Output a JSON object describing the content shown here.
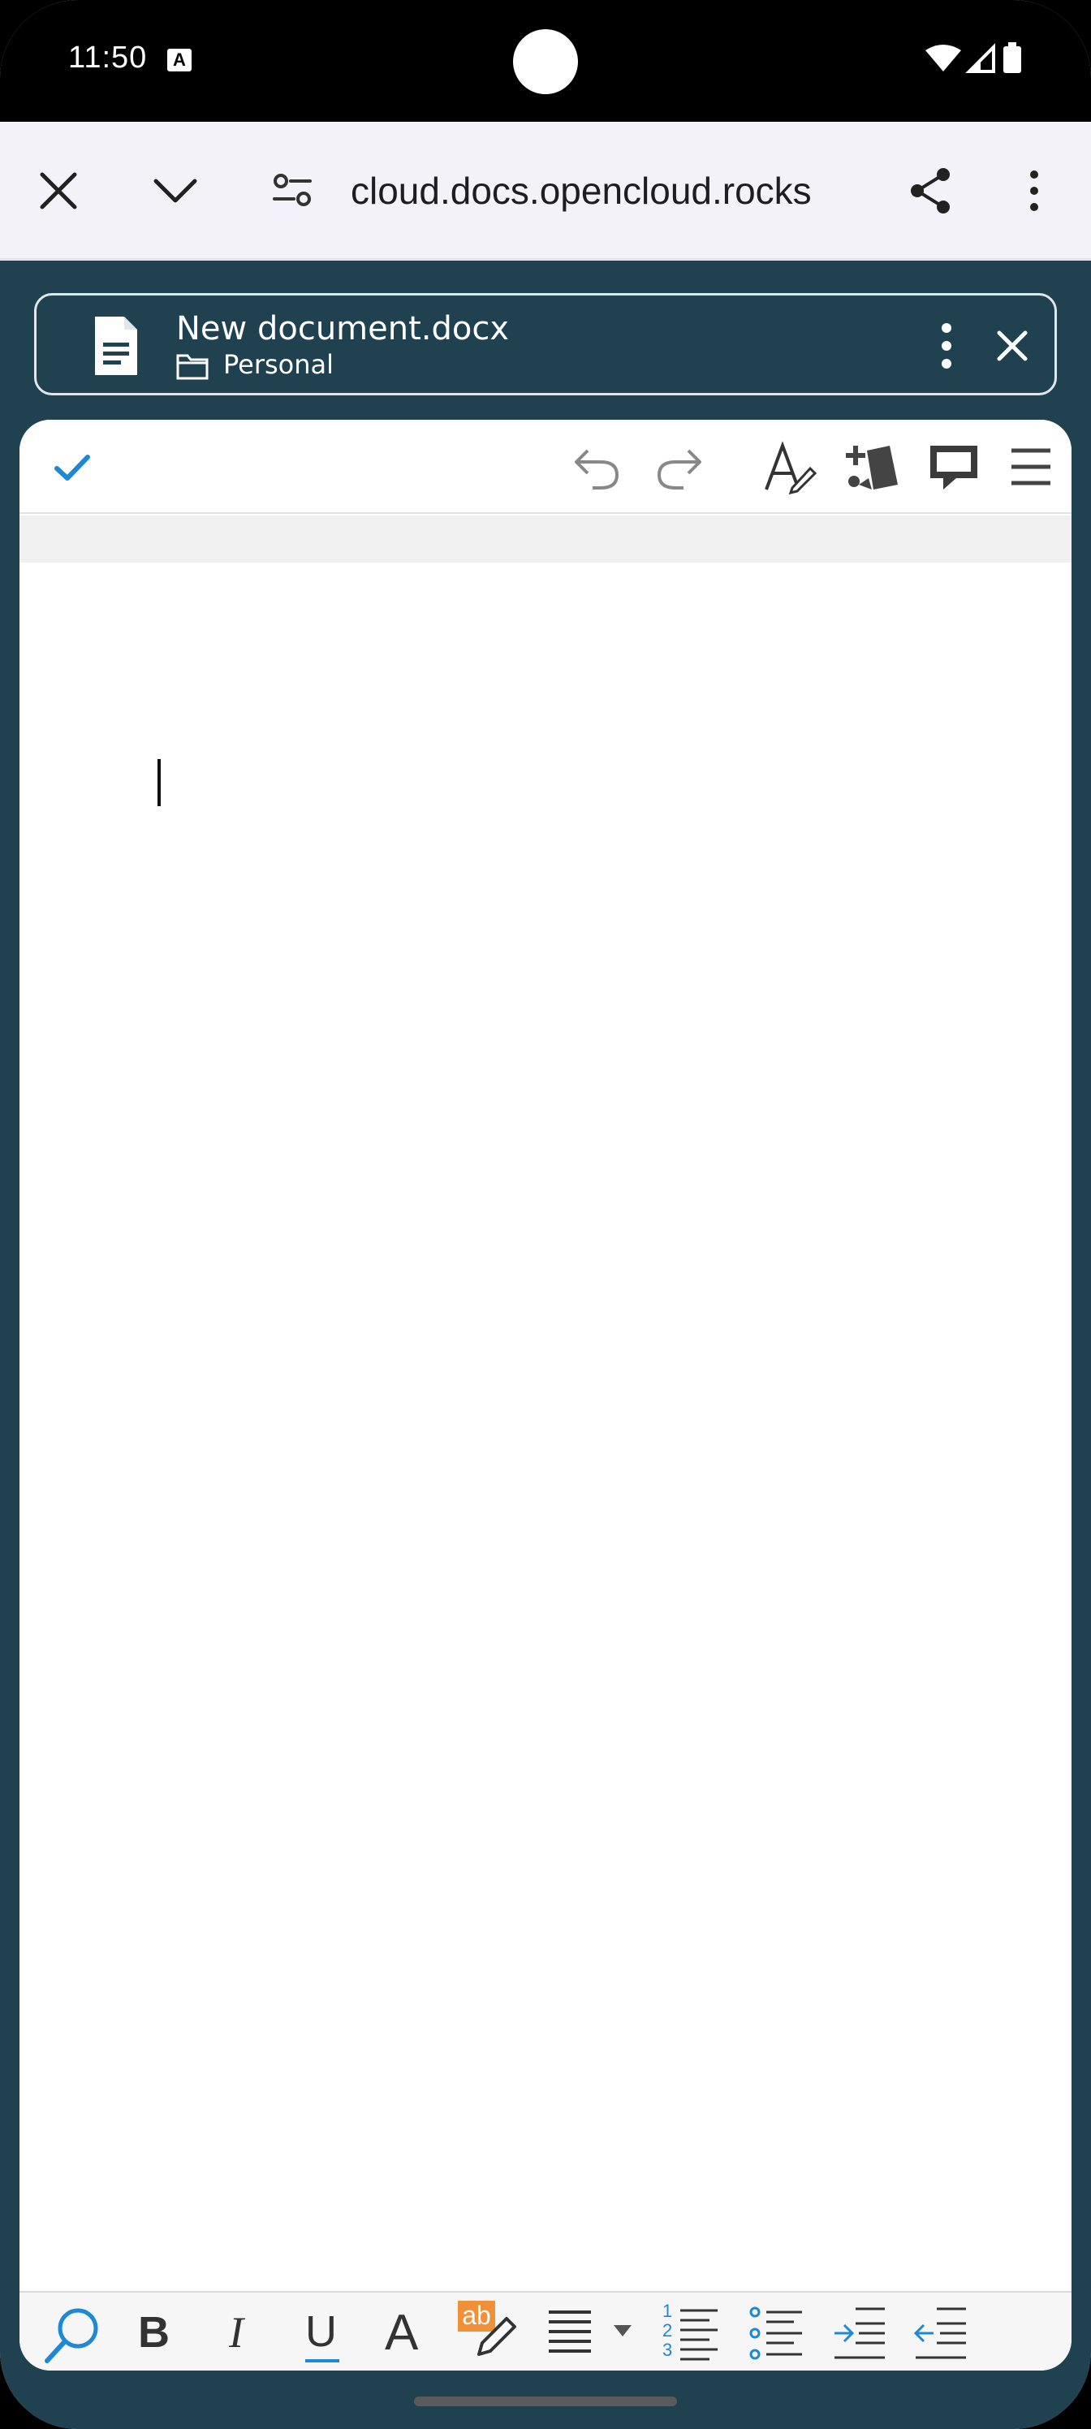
{
  "status_bar": {
    "time": "11:50",
    "notification_badge": "A",
    "icons": [
      "wifi-icon",
      "signal-icon",
      "battery-icon"
    ]
  },
  "browser": {
    "url": "cloud.docs.opencloud.rocks",
    "icons": [
      "close-icon",
      "chevron-down-icon",
      "site-settings-icon",
      "share-icon",
      "more-vert-icon"
    ]
  },
  "file_header": {
    "file_name": "New document.docx",
    "folder": "Personal",
    "icons": [
      "document-icon",
      "folder-icon",
      "more-vert-icon",
      "close-icon"
    ]
  },
  "editor_toolbar": {
    "icons": [
      "checkmark-icon",
      "undo-icon",
      "redo-icon",
      "text-style-icon",
      "insert-icon",
      "comment-icon",
      "hamburger-menu-icon"
    ]
  },
  "format_toolbar": {
    "bold_label": "B",
    "italic_label": "I",
    "underline_label": "U",
    "font_color_label": "A",
    "highlight_label": "ab",
    "numbered_list_digits": [
      "1",
      "2",
      "3"
    ],
    "icons": [
      "search-icon",
      "bold-icon",
      "italic-icon",
      "underline-icon",
      "font-color-icon",
      "highlight-icon",
      "align-icon",
      "dropdown-arrow-icon",
      "numbered-list-icon",
      "bullet-list-icon",
      "indent-icon",
      "outdent-icon"
    ]
  },
  "colors": {
    "app_background": "#1f4150",
    "accent_blue": "#1e88d6",
    "highlight_orange": "#f0913a"
  }
}
